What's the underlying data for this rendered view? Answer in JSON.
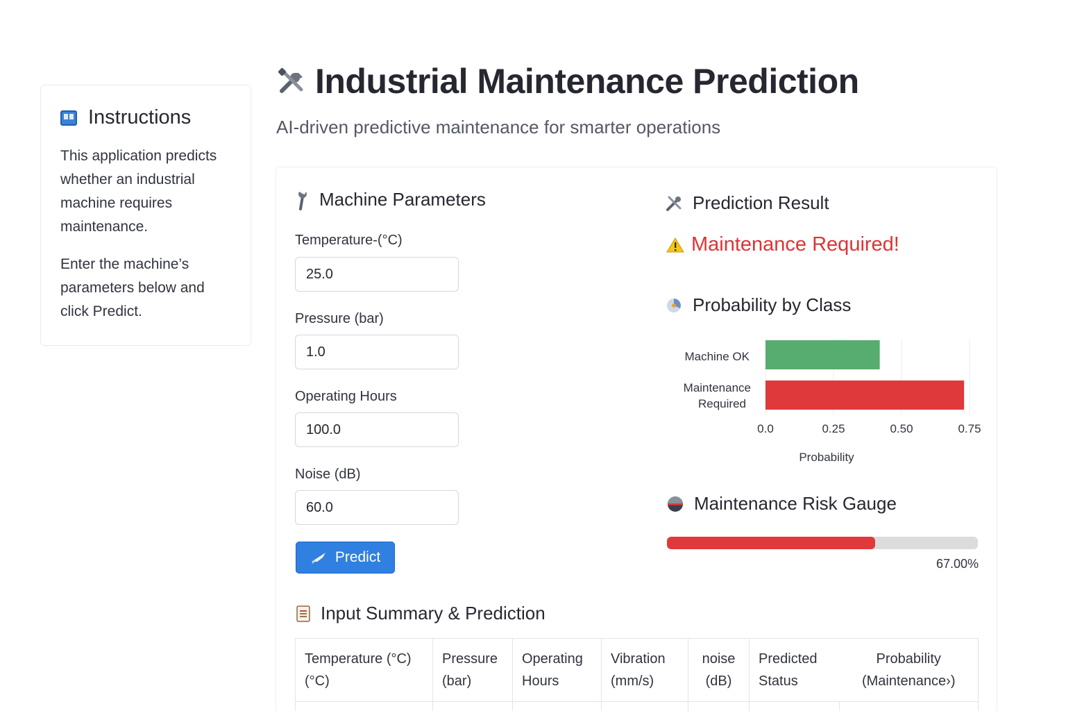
{
  "sidebar": {
    "title": "Instructions",
    "paragraph1": "This application predicts whether an industrial machine requires maintenance.",
    "paragraph2": "Enter the machine’s parameters below and click Predict."
  },
  "header": {
    "title": "Industrial Maintenance Prediction",
    "subtitle": "AI-driven predictive maintenance for smarter operations"
  },
  "params": {
    "heading": "Machine Parameters",
    "fields": [
      {
        "label": "Temperature-(°C)",
        "value": "25.0"
      },
      {
        "label": "Pressure (bar)",
        "value": "1.0"
      },
      {
        "label": "Operating Hours",
        "value": "100.0"
      },
      {
        "label": "Noise (dB)",
        "value": "60.0"
      }
    ],
    "predict_label": "Predict"
  },
  "result": {
    "heading": "Prediction Result",
    "status": "Maintenance Required!",
    "status_color": "#e03234"
  },
  "probability": {
    "heading": "Probability by Class"
  },
  "chart_data": {
    "type": "bar",
    "orientation": "horizontal",
    "categories": [
      "Machine OK",
      "Maintenance Required"
    ],
    "values": [
      0.42,
      0.73
    ],
    "colors": [
      "#57ac6f",
      "#e0393b"
    ],
    "xlabel": "Probability",
    "xticks": [
      "0.0",
      "0.25",
      "0.50",
      "0.75"
    ],
    "xlim": [
      0,
      0.75
    ],
    "grid": true
  },
  "gauge": {
    "heading": "Maintenance Risk Gauge",
    "value": 0.67,
    "label": "67.00%"
  },
  "summary": {
    "heading": "Input Summary & Prediction",
    "columns": [
      {
        "line1": "Temperature (°C)",
        "line2": "(°C)"
      },
      {
        "line1": "Pressure",
        "line2": "(bar)"
      },
      {
        "line1": "Operating",
        "line2": "Hours"
      },
      {
        "line1": "Vibration",
        "line2": "(mm/s)"
      },
      {
        "line1": "noise",
        "line2": "(dB)"
      },
      {
        "line1": "Predicted",
        "line2": "Status"
      },
      {
        "line1": "Probability",
        "line2": "(Maintenance›)"
      }
    ]
  },
  "colors": {
    "accent": "#2f80e0",
    "danger": "#e0393b",
    "ok": "#57ac6f"
  }
}
